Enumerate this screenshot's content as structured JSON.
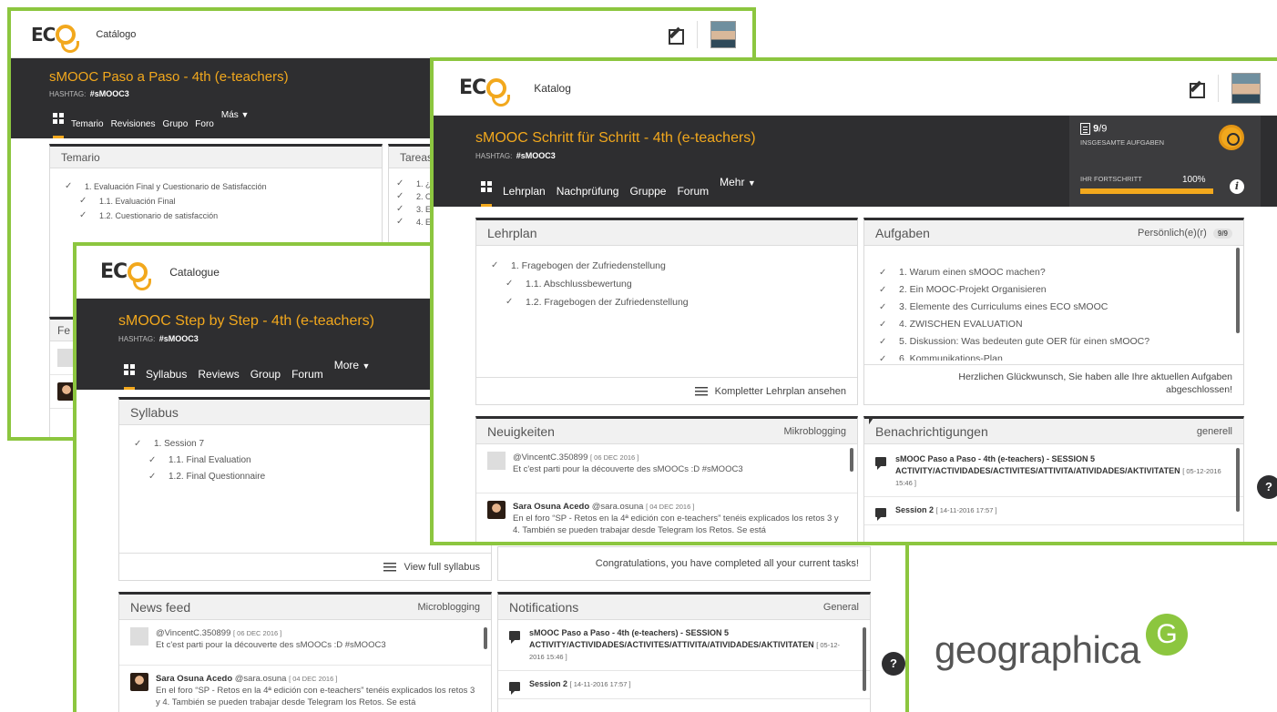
{
  "colors": {
    "accent": "#f2a81d",
    "frame": "#8cc63f",
    "hero_bg": "#2e2e30"
  },
  "logo_text": "EC",
  "spanish": {
    "catalog": "Catálogo",
    "course_title": "sMOOC Paso a Paso - 4th (e-teachers)",
    "hashtag_label": "HASHTAG:",
    "hashtag_value": "#sMOOC3",
    "tabs": [
      "Temario",
      "Revisiones",
      "Grupo",
      "Foro",
      "Más"
    ],
    "syllabus_title": "Temario",
    "syllabus_items": [
      "1. Evaluación Final y Cuestionario de Satisfacción",
      "1.1. Evaluación Final",
      "1.2. Cuestionario de satisfacción"
    ],
    "tasks_title": "Tareas",
    "tasks_items": [
      "1. ¿",
      "2. O",
      "3. E",
      "4. E"
    ],
    "feed_title": "Fe"
  },
  "english": {
    "catalog": "Catalogue",
    "course_title": "sMOOC Step by Step - 4th (e-teachers)",
    "hashtag_label": "HASHTAG:",
    "hashtag_value": "#sMOOC3",
    "tabs": [
      "Syllabus",
      "Reviews",
      "Group",
      "Forum",
      "More"
    ],
    "syllabus_title": "Syllabus",
    "syllabus_items": [
      "1. Session 7",
      "1.1. Final Evaluation",
      "1.2. Final Questionnaire"
    ],
    "view_full": "View full syllabus",
    "tasks_done": "Congratulations, you have completed all your current tasks!",
    "feed_title": "News feed",
    "feed_filter": "Microblogging",
    "notif_title": "Notifications",
    "notif_filter": "General",
    "feed": [
      {
        "user": "@VincentC.350899",
        "date": "[ 06 DEC 2016 ]",
        "text": "Et c'est parti pour la découverte des sMOOCs :D #sMOOC3"
      },
      {
        "name": "Sara Osuna Acedo",
        "user": "@sara.osuna",
        "date": "[ 04 DEC 2016 ]",
        "text": "En el foro “SP - Retos en la 4ª edición con e-teachers” tenéis explicados los retos 3 y 4. También se pueden trabajar desde Telegram los Retos. Se está"
      }
    ],
    "notifications": [
      {
        "title": "sMOOC Paso a Paso - 4th (e-teachers) - SESSION 5 ACTIVITY/ACTIVIDADES/ACTIVITES/ATTIVITA/ATIVIDADES/AKTIVITATEN",
        "date": "[ 05-12-2016 15:46 ]"
      },
      {
        "title": "Session 2",
        "date": "[ 14-11-2016 17:57 ]"
      }
    ]
  },
  "german": {
    "catalog": "Katalog",
    "course_title": "sMOOC Schritt für Schritt - 4th (e-teachers)",
    "hashtag_label": "HASHTAG:",
    "hashtag_value": "#sMOOC3",
    "tabs": [
      "Lehrplan",
      "Nachprüfung",
      "Gruppe",
      "Forum",
      "Mehr"
    ],
    "tasks_count": "9",
    "tasks_total": "/9",
    "tasks_label": "INSGESAMTE AUFGABEN",
    "progress_label": "IHR FORTSCHRITT",
    "progress_value": "100%",
    "progress_fraction": 1.0,
    "syllabus_title": "Lehrplan",
    "syllabus_items": [
      "1. Fragebogen der Zufriedenstellung",
      "1.1. Abschlussbewertung",
      "1.2. Fragebogen der Zufriedenstellung"
    ],
    "view_full": "Kompletter Lehrplan ansehen",
    "tasks_title": "Aufgaben",
    "tasks_filter": "Persönlich(e)(r)",
    "tasks_badge": "9/9",
    "tasks_items": [
      "1. Warum einen sMOOC machen?",
      "2. Ein MOOC-Projekt Organisieren",
      "3. Elemente des Curriculums eines ECO sMOOC",
      "4. ZWISCHEN EVALUATION",
      "5. Diskussion: Was bedeuten gute OER für einen sMOOC?",
      "6. Kommunikations-Plan"
    ],
    "tasks_done": "Herzlichen Glückwunsch, Sie haben alle Ihre aktuellen Aufgaben abgeschlossen!",
    "feed_title": "Neuigkeiten",
    "feed_filter": "Mikroblogging",
    "notif_title": "Benachrichtigungen",
    "notif_filter": "generell",
    "feed": [
      {
        "user": "@VincentC.350899",
        "date": "[ 06 DEC 2016 ]",
        "text": "Et c'est parti pour la découverte des sMOOCs :D #sMOOC3"
      },
      {
        "name": "Sara Osuna Acedo",
        "user": "@sara.osuna",
        "date": "[ 04 DEC 2016 ]",
        "text": "En el foro “SP - Retos en la 4ª edición con e-teachers” tenéis explicados los retos 3 y 4. También se pueden trabajar desde Telegram los Retos. Se está"
      }
    ],
    "notifications": [
      {
        "title": "sMOOC Paso a Paso - 4th (e-teachers) - SESSION 5 ACTIVITY/ACTIVIDADES/ACTIVITES/ATTIVITA/ATIVIDADES/AKTIVITATEN",
        "date": "[ 05-12-2016 15:46 ]"
      },
      {
        "title": "Session 2",
        "date": "[ 14-11-2016 17:57 ]"
      }
    ]
  },
  "help_label": "?",
  "brand": {
    "word": "geographica",
    "mark": "G"
  }
}
